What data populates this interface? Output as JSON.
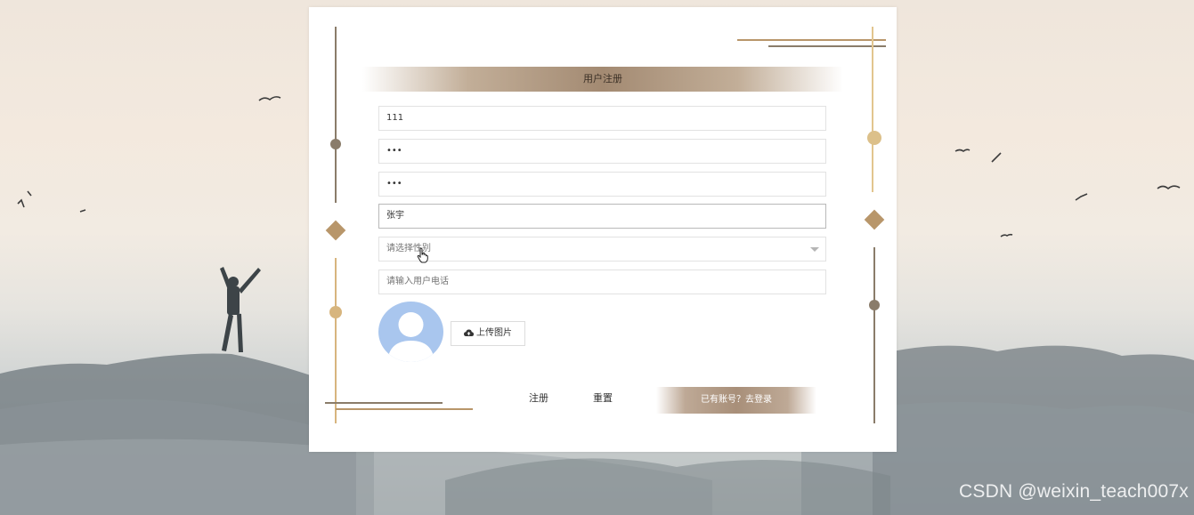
{
  "form": {
    "title": "用户注册",
    "fields": {
      "account": "111",
      "password": "•••",
      "confirm_password": "•••",
      "name": "张宇",
      "gender_placeholder": "请选择性别",
      "phone_placeholder": "请输入用户电话"
    },
    "upload_label": "上传图片",
    "register_label": "注册",
    "reset_label": "重置",
    "login_link_label": "已有账号？去登录"
  },
  "watermark": "CSDN @weixin_teach007x",
  "colors": {
    "accent_gold": "#d7b57e",
    "accent_brown": "#a38a72",
    "avatar_blue": "#a9c6ee"
  }
}
